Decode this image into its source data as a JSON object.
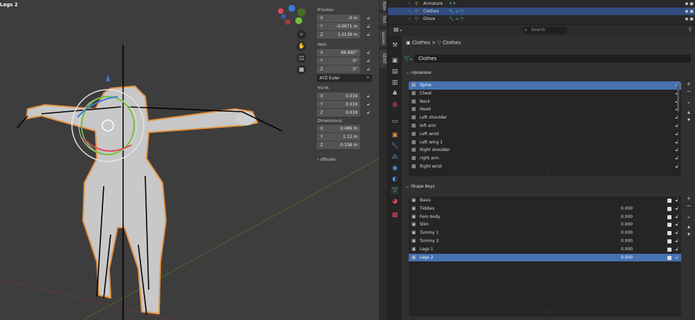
{
  "viewport": {
    "object_title": "Legs 2",
    "nav_icons": [
      "zoom-icon",
      "hand-icon",
      "camera-icon",
      "grid-icon"
    ],
    "npanel": {
      "location_label": "ตำแหน่ง:",
      "location": [
        {
          "axis": "X",
          "value": "-0 m"
        },
        {
          "axis": "Y",
          "value": "-0.0071 m"
        },
        {
          "axis": "Z",
          "value": "1.0139 m"
        }
      ],
      "rotation_label": "หมุน:",
      "rotation": [
        {
          "axis": "X",
          "value": "88.892°"
        },
        {
          "axis": "Y",
          "value": "0°"
        },
        {
          "axis": "Z",
          "value": "0°"
        }
      ],
      "rotation_mode": "XYZ Euler",
      "scale_label": "ขนาด:",
      "scale": [
        {
          "axis": "X",
          "value": "0.019"
        },
        {
          "axis": "Y",
          "value": "0.019"
        },
        {
          "axis": "Z",
          "value": "0.019"
        }
      ],
      "dimensions_label": "Dimensions:",
      "dimensions": [
        {
          "axis": "X",
          "value": "0.486 m"
        },
        {
          "axis": "Y",
          "value": "1.12 m"
        },
        {
          "axis": "Z",
          "value": "0.338 m"
        }
      ],
      "collapsed_section": "ปรับแต่ง"
    },
    "side_tabs": [
      "Item",
      "Tool",
      "มุมมอง",
      "SENT"
    ]
  },
  "outliner": {
    "rows": [
      {
        "name": "Armature",
        "selected": false
      },
      {
        "name": "Clothes",
        "selected": true
      },
      {
        "name": "Glove",
        "selected": false
      }
    ]
  },
  "properties": {
    "search_placeholder": "Search",
    "breadcrumb_object": "Clothes",
    "breadcrumb_sep": ">",
    "breadcrumb_data": "Clothes",
    "datablock_name": "Clothes",
    "vertex_groups_label": "กลุ่มจุดยอด",
    "vertex_groups": [
      "Spine",
      "Chest",
      "Neck",
      "Head",
      "Left shoulder",
      "left arm",
      "Left wrist",
      "Left wing 1",
      "Right shoulder",
      "right arm",
      "Right wrist"
    ],
    "vertex_group_selected": 0,
    "shape_keys_label": "Shape Keys",
    "shape_keys": [
      {
        "name": "Basis",
        "value": ""
      },
      {
        "name": "Tiddies",
        "value": "0.000"
      },
      {
        "name": "Fem body",
        "value": "0.000"
      },
      {
        "name": "Slim",
        "value": "0.000"
      },
      {
        "name": "Tummy 1",
        "value": "0.000"
      },
      {
        "name": "Tummy 2",
        "value": "0.000"
      },
      {
        "name": "Legs 1",
        "value": "0.000"
      },
      {
        "name": "Legs 2",
        "value": "0.000"
      }
    ],
    "shape_key_selected": 7
  },
  "colors": {
    "selection_blue": "#4772b3",
    "outline_orange": "#e69340",
    "mesh_gray": "#c8c8c8"
  }
}
